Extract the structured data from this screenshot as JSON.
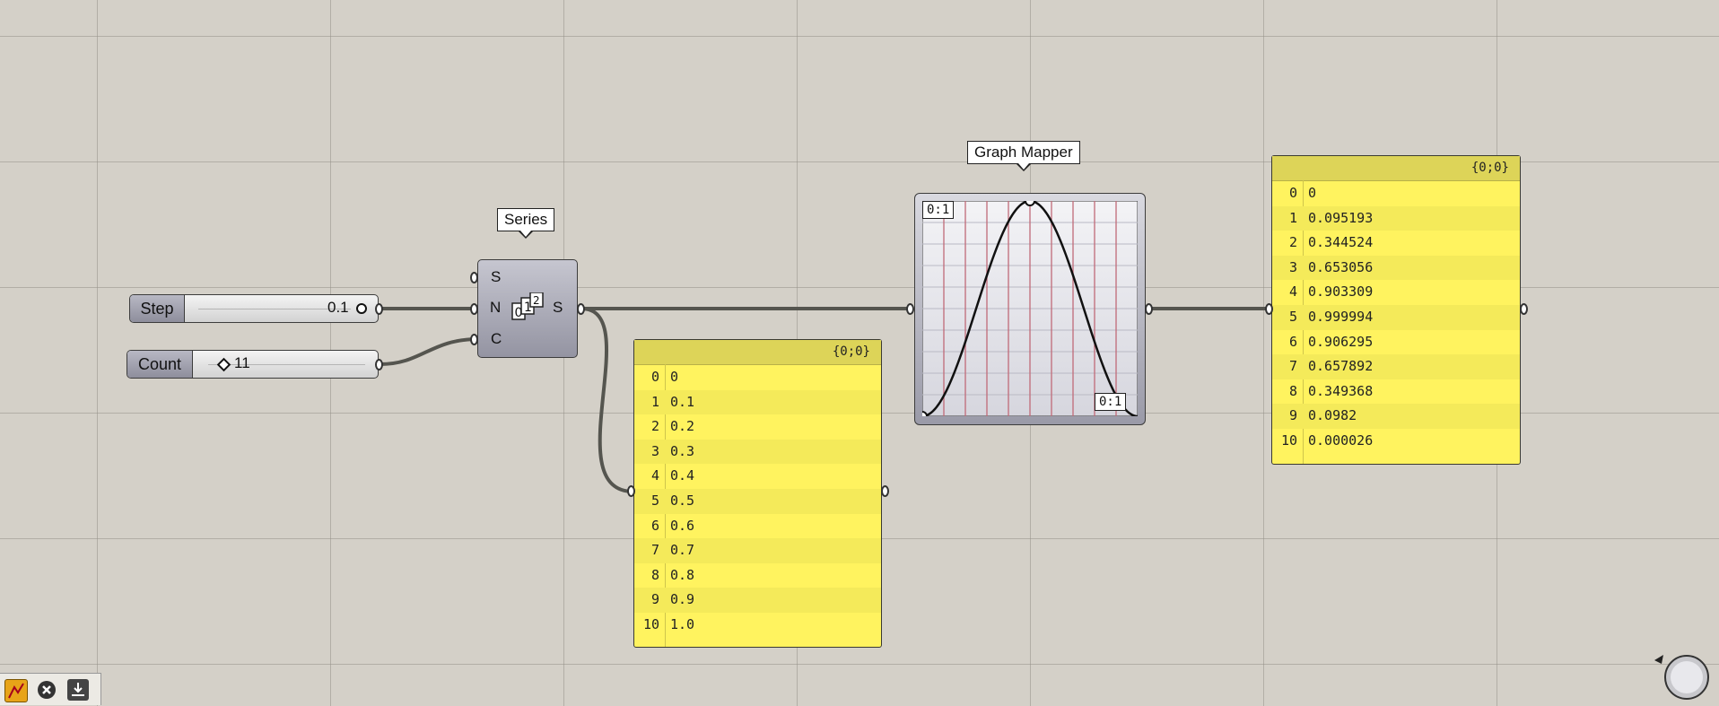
{
  "step_slider": {
    "label": "Step",
    "value": "0.1"
  },
  "count_slider": {
    "label": "Count",
    "value": "11"
  },
  "series": {
    "tag": "Series",
    "inputs": [
      "S",
      "N",
      "C"
    ],
    "output": "S",
    "icon": "number-series-icon"
  },
  "graph_mapper": {
    "tag": "Graph Mapper",
    "min_label": "0:1",
    "max_label": "0:1",
    "curve": "sine-bell"
  },
  "panel_left": {
    "path": "{0;0}",
    "rows": [
      {
        "i": "0",
        "v": "0"
      },
      {
        "i": "1",
        "v": "0.1"
      },
      {
        "i": "2",
        "v": "0.2"
      },
      {
        "i": "3",
        "v": "0.3"
      },
      {
        "i": "4",
        "v": "0.4"
      },
      {
        "i": "5",
        "v": "0.5"
      },
      {
        "i": "6",
        "v": "0.6"
      },
      {
        "i": "7",
        "v": "0.7"
      },
      {
        "i": "8",
        "v": "0.8"
      },
      {
        "i": "9",
        "v": "0.9"
      },
      {
        "i": "10",
        "v": "1.0"
      }
    ]
  },
  "panel_right": {
    "path": "{0;0}",
    "rows": [
      {
        "i": "0",
        "v": "0"
      },
      {
        "i": "1",
        "v": "0.095193"
      },
      {
        "i": "2",
        "v": "0.344524"
      },
      {
        "i": "3",
        "v": "0.653056"
      },
      {
        "i": "4",
        "v": "0.903309"
      },
      {
        "i": "5",
        "v": "0.999994"
      },
      {
        "i": "6",
        "v": "0.906295"
      },
      {
        "i": "7",
        "v": "0.657892"
      },
      {
        "i": "8",
        "v": "0.349368"
      },
      {
        "i": "9",
        "v": "0.0982"
      },
      {
        "i": "10",
        "v": "0.000026"
      }
    ]
  },
  "toolbar": {
    "icons": [
      "preview-icon",
      "disable-icon",
      "bake-icon"
    ]
  },
  "colors": {
    "canvas": "#d4d0c8",
    "panel": "#fff35f",
    "wire": "#4a4a44",
    "curve": "#111111",
    "grid_line": "#c06a78"
  }
}
